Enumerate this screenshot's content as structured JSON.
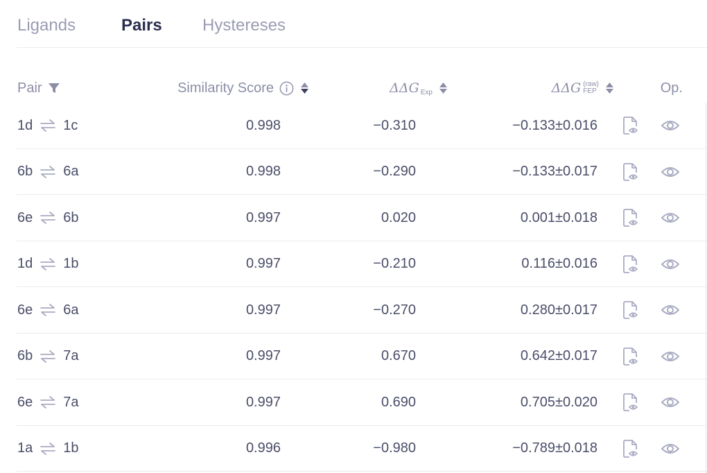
{
  "tabs": [
    {
      "label": "Ligands",
      "active": false
    },
    {
      "label": "Pairs",
      "active": true
    },
    {
      "label": "Hystereses",
      "active": false
    }
  ],
  "header": {
    "pair": "Pair",
    "similarity": "Similarity Score",
    "dg_exp_symbol": "ΔΔG",
    "dg_exp_sub": "Exp",
    "dg_fep_symbol": "ΔΔG",
    "dg_fep_sup": "(raw)",
    "dg_fep_sub": "FEP",
    "op": "Op."
  },
  "icons": {
    "filter": "filter-icon",
    "info": "info-icon",
    "swap": "swap-arrows-icon",
    "document": "document-view-icon",
    "view": "eye-icon"
  },
  "colors": {
    "text": "#4a4d68",
    "muted": "#8c8ea8",
    "active_tab": "#2a2d4d",
    "icon": "#a9abc2"
  },
  "rows": [
    {
      "a": "1d",
      "b": "1c",
      "similarity": "0.998",
      "dg_exp": "−0.310",
      "dg_fep": "−0.133±0.016"
    },
    {
      "a": "6b",
      "b": "6a",
      "similarity": "0.998",
      "dg_exp": "−0.290",
      "dg_fep": "−0.133±0.017"
    },
    {
      "a": "6e",
      "b": "6b",
      "similarity": "0.997",
      "dg_exp": "0.020",
      "dg_fep": "0.001±0.018"
    },
    {
      "a": "1d",
      "b": "1b",
      "similarity": "0.997",
      "dg_exp": "−0.210",
      "dg_fep": "0.116±0.016"
    },
    {
      "a": "6e",
      "b": "6a",
      "similarity": "0.997",
      "dg_exp": "−0.270",
      "dg_fep": "0.280±0.017"
    },
    {
      "a": "6b",
      "b": "7a",
      "similarity": "0.997",
      "dg_exp": "0.670",
      "dg_fep": "0.642±0.017"
    },
    {
      "a": "6e",
      "b": "7a",
      "similarity": "0.997",
      "dg_exp": "0.690",
      "dg_fep": "0.705±0.020"
    },
    {
      "a": "1a",
      "b": "1b",
      "similarity": "0.996",
      "dg_exp": "−0.980",
      "dg_fep": "−0.789±0.018"
    }
  ]
}
